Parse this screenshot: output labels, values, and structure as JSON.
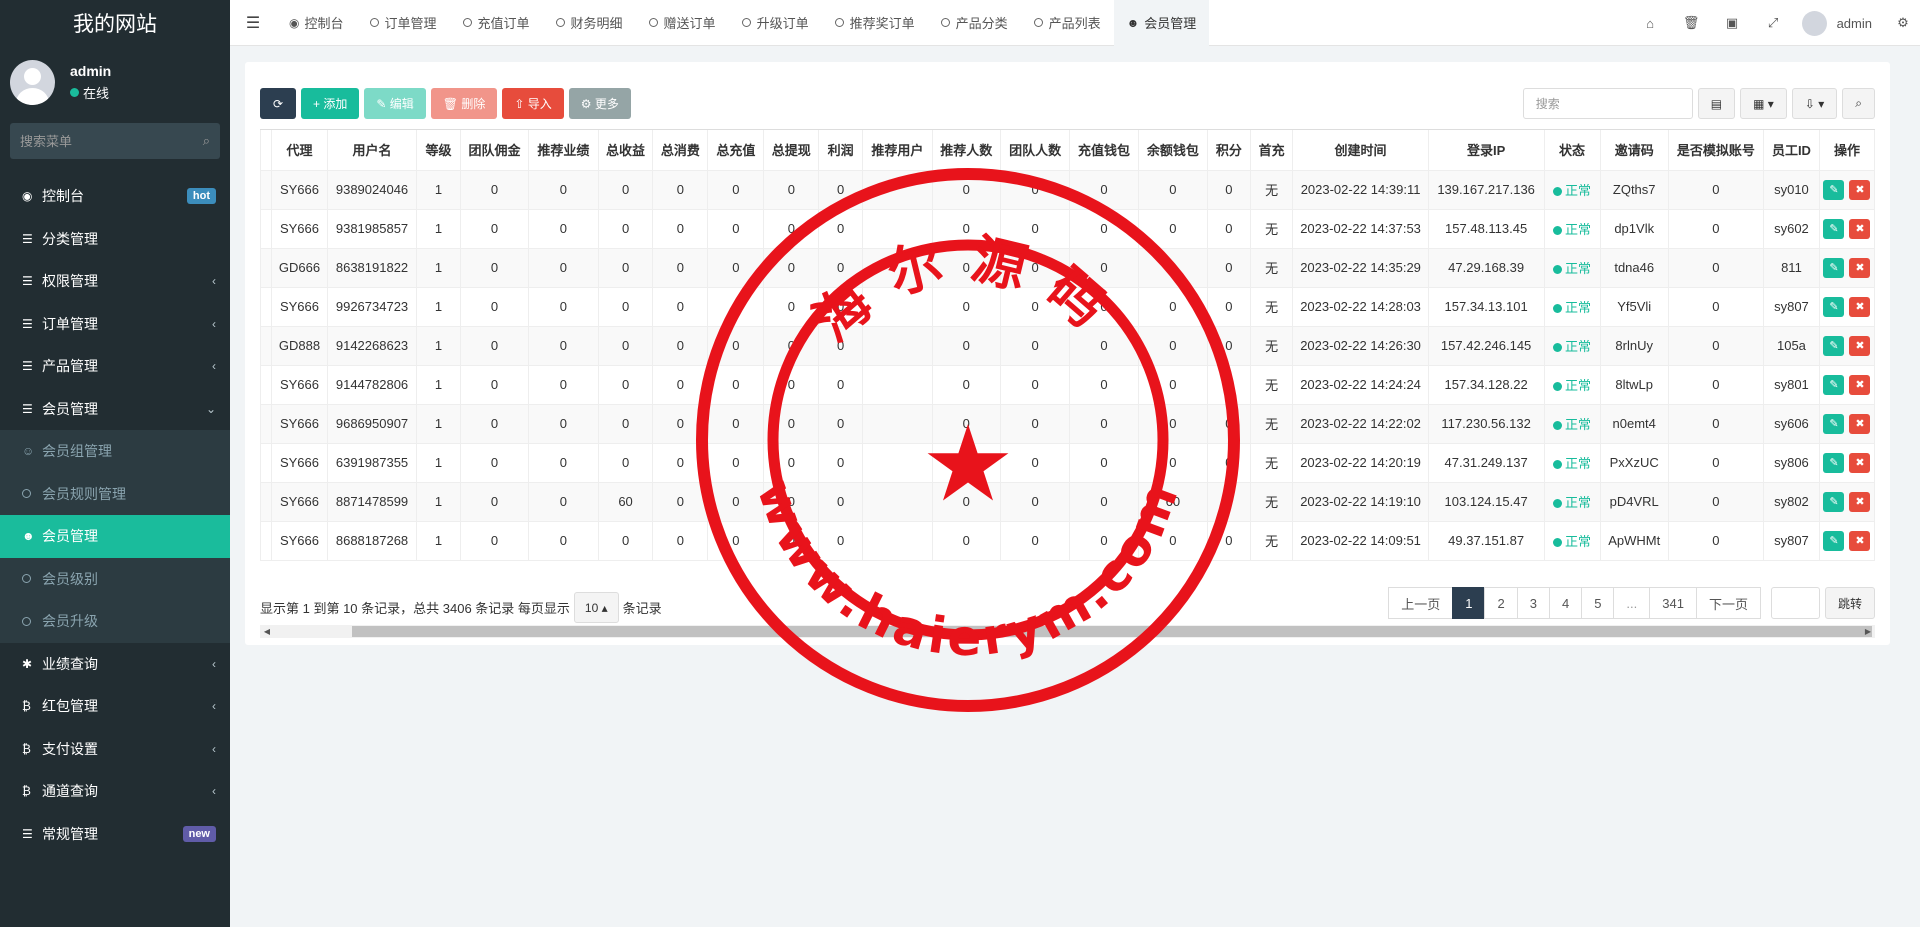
{
  "app": {
    "title": "我的网站"
  },
  "user": {
    "name": "admin",
    "status": "在线"
  },
  "sidebar": {
    "search_placeholder": "搜索菜单",
    "items": [
      {
        "label": "控制台",
        "icon": "dashboard-icon",
        "glyph": "◉",
        "badge": "hot"
      },
      {
        "label": "分类管理",
        "icon": "list-icon",
        "glyph": "☰"
      },
      {
        "label": "权限管理",
        "icon": "list-icon",
        "glyph": "☰",
        "chevron": "‹"
      },
      {
        "label": "订单管理",
        "icon": "list-icon",
        "glyph": "☰",
        "chevron": "‹"
      },
      {
        "label": "产品管理",
        "icon": "list-icon",
        "glyph": "☰",
        "chevron": "‹"
      },
      {
        "label": "会员管理",
        "icon": "list-icon",
        "glyph": "☰",
        "chevron": "⌄"
      }
    ],
    "submenu": [
      {
        "label": "会员组管理",
        "icon": "users-icon"
      },
      {
        "label": "会员规则管理",
        "icon": "circle-icon"
      },
      {
        "label": "会员管理",
        "icon": "user-icon",
        "active": true
      },
      {
        "label": "会员级别",
        "icon": "circle-icon"
      },
      {
        "label": "会员升级",
        "icon": "circle-icon"
      }
    ],
    "items2": [
      {
        "label": "业绩查询",
        "icon": "asterisk-icon",
        "glyph": "✱",
        "chevron": "‹"
      },
      {
        "label": "红包管理",
        "icon": "bitcoin-icon",
        "glyph": "₿",
        "chevron": "‹"
      },
      {
        "label": "支付设置",
        "icon": "bitcoin-icon",
        "glyph": "₿",
        "chevron": "‹"
      },
      {
        "label": "通道查询",
        "icon": "bitcoin-icon",
        "glyph": "₿",
        "chevron": "‹"
      },
      {
        "label": "常规管理",
        "icon": "list-icon",
        "glyph": "☰",
        "badge": "new"
      }
    ]
  },
  "nav": {
    "tabs": [
      "控制台",
      "订单管理",
      "充值订单",
      "财务明细",
      "赠送订单",
      "升级订单",
      "推荐奖订单",
      "产品分类",
      "产品列表",
      "会员管理"
    ],
    "user_name": "admin"
  },
  "toolbar": {
    "add": "添加",
    "edit": "编辑",
    "delete": "删除",
    "import": "导入",
    "more": "更多",
    "search_placeholder": "搜索"
  },
  "table": {
    "columns": [
      "代理",
      "用户名",
      "等级",
      "团队佣金",
      "推荐业绩",
      "总收益",
      "总消费",
      "总充值",
      "总提现",
      "利润",
      "推荐用户",
      "推荐人数",
      "团队人数",
      "充值钱包",
      "余额钱包",
      "积分",
      "首充",
      "创建时间",
      "登录IP",
      "状态",
      "邀请码",
      "是否模拟账号",
      "员工ID",
      "操作"
    ],
    "rows": [
      [
        "SY666",
        "9389024046",
        "1",
        "0",
        "0",
        "0",
        "0",
        "0",
        "0",
        "0",
        "",
        "0",
        "0",
        "0",
        "0",
        "0",
        "无",
        "2023-02-22 14:39:11",
        "139.167.217.136",
        "正常",
        "ZQths7",
        "0",
        "sy010"
      ],
      [
        "SY666",
        "9381985857",
        "1",
        "0",
        "0",
        "0",
        "0",
        "0",
        "0",
        "0",
        "",
        "0",
        "0",
        "0",
        "0",
        "0",
        "无",
        "2023-02-22 14:37:53",
        "157.48.113.45",
        "正常",
        "dp1Vlk",
        "0",
        "sy602"
      ],
      [
        "GD666",
        "8638191822",
        "1",
        "0",
        "0",
        "0",
        "0",
        "0",
        "0",
        "0",
        "",
        "0",
        "0",
        "0",
        "0",
        "0",
        "无",
        "2023-02-22 14:35:29",
        "47.29.168.39",
        "正常",
        "tdna46",
        "0",
        "811"
      ],
      [
        "SY666",
        "9926734723",
        "1",
        "0",
        "0",
        "0",
        "0",
        "0",
        "0",
        "0",
        "",
        "0",
        "0",
        "0",
        "0",
        "0",
        "无",
        "2023-02-22 14:28:03",
        "157.34.13.101",
        "正常",
        "Yf5Vli",
        "0",
        "sy807"
      ],
      [
        "GD888",
        "9142268623",
        "1",
        "0",
        "0",
        "0",
        "0",
        "0",
        "0",
        "0",
        "",
        "0",
        "0",
        "0",
        "0",
        "0",
        "无",
        "2023-02-22 14:26:30",
        "157.42.246.145",
        "正常",
        "8rlnUy",
        "0",
        "105a"
      ],
      [
        "SY666",
        "9144782806",
        "1",
        "0",
        "0",
        "0",
        "0",
        "0",
        "0",
        "0",
        "",
        "0",
        "0",
        "0",
        "0",
        "0",
        "无",
        "2023-02-22 14:24:24",
        "157.34.128.22",
        "正常",
        "8ltwLp",
        "0",
        "sy801"
      ],
      [
        "SY666",
        "9686950907",
        "1",
        "0",
        "0",
        "0",
        "0",
        "0",
        "0",
        "0",
        "",
        "0",
        "0",
        "0",
        "0",
        "0",
        "无",
        "2023-02-22 14:22:02",
        "117.230.56.132",
        "正常",
        "n0emt4",
        "0",
        "sy606"
      ],
      [
        "SY666",
        "6391987355",
        "1",
        "0",
        "0",
        "0",
        "0",
        "0",
        "0",
        "0",
        "",
        "0",
        "0",
        "0",
        "0",
        "0",
        "无",
        "2023-02-22 14:20:19",
        "47.31.249.137",
        "正常",
        "PxXzUC",
        "0",
        "sy806"
      ],
      [
        "SY666",
        "8871478599",
        "1",
        "0",
        "0",
        "60",
        "0",
        "0",
        "0",
        "0",
        "",
        "0",
        "0",
        "0",
        "60",
        "0",
        "无",
        "2023-02-22 14:19:10",
        "103.124.15.47",
        "正常",
        "pD4VRL",
        "0",
        "sy802"
      ],
      [
        "SY666",
        "8688187268",
        "1",
        "0",
        "0",
        "0",
        "0",
        "0",
        "0",
        "0",
        "",
        "0",
        "0",
        "0",
        "0",
        "0",
        "无",
        "2023-02-22 14:09:51",
        "49.37.151.87",
        "正常",
        "ApWHMt",
        "0",
        "sy807"
      ]
    ]
  },
  "pagination": {
    "info_prefix": "显示第 1 到第 10 条记录，总共 3406 条记录 每页显示",
    "page_size": "10",
    "info_suffix": "条记录",
    "prev": "上一页",
    "pages": [
      "1",
      "2",
      "3",
      "4",
      "5",
      "...",
      "341"
    ],
    "current": "1",
    "next": "下一页",
    "go": "跳转"
  },
  "watermark": {
    "top_text": "海尔源码",
    "bottom_text": "www.haierym.com",
    "color": "#e8131b"
  },
  "colors": {
    "sidebar_bg": "#222d32",
    "accent": "#18bc9c",
    "danger": "#e74c3c",
    "primary_dark": "#2c3e50"
  }
}
